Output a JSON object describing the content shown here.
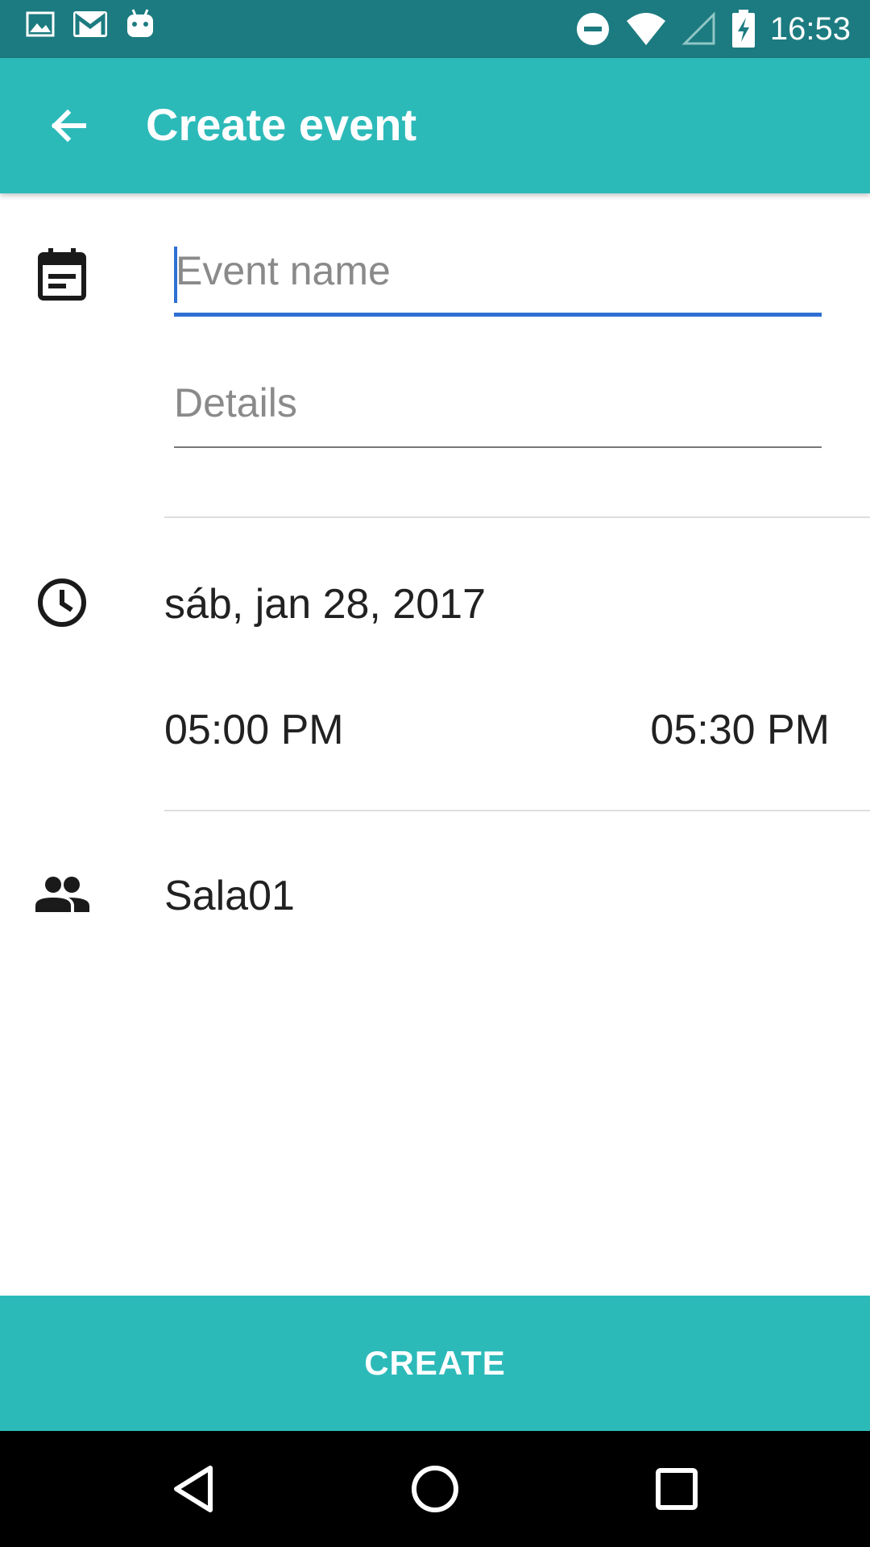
{
  "status_bar": {
    "time": "16:53",
    "left_icons": [
      "image-icon",
      "gmail-icon",
      "android-icon"
    ],
    "right_icons": [
      "do-not-disturb-icon",
      "wifi-icon",
      "signal-icon",
      "battery-charging-icon"
    ]
  },
  "app_bar": {
    "title": "Create event",
    "back_icon": "arrow-back-icon"
  },
  "form": {
    "event_name": {
      "placeholder": "Event name",
      "value": ""
    },
    "details": {
      "placeholder": "Details",
      "value": ""
    },
    "date": "sáb, jan 28, 2017",
    "start_time": "05:00 PM",
    "end_time": "05:30 PM",
    "room": "Sala01"
  },
  "actions": {
    "create_label": "CREATE"
  },
  "colors": {
    "accent": "#2cbab9",
    "status_bar": "#1c7b80",
    "focus_line": "#2e6fd3"
  }
}
